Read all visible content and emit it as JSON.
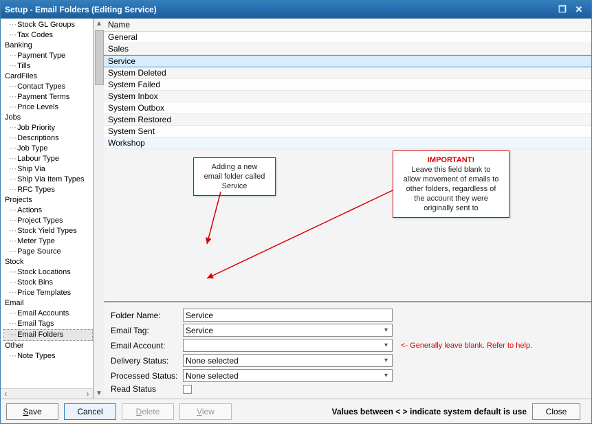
{
  "window": {
    "title": "Setup - Email Folders (Editing Service)"
  },
  "tree": {
    "groups": [
      {
        "label": "",
        "items": [
          "Stock GL Groups",
          "Tax Codes"
        ]
      },
      {
        "label": "Banking",
        "items": [
          "Payment Type",
          "Tills"
        ]
      },
      {
        "label": "CardFiles",
        "items": [
          "Contact Types",
          "Payment Terms",
          "Price Levels"
        ]
      },
      {
        "label": "Jobs",
        "items": [
          "Job Priority",
          "Descriptions",
          "Job Type",
          "Labour Type",
          "Ship Via",
          "Ship Via Item Types",
          "RFC Types"
        ]
      },
      {
        "label": "Projects",
        "items": [
          "Actions",
          "Project Types",
          "Stock Yield Types",
          "Meter Type",
          "Page Source"
        ]
      },
      {
        "label": "Stock",
        "items": [
          "Stock Locations",
          "Stock Bins",
          "Price Templates"
        ]
      },
      {
        "label": "Email",
        "items": [
          "Email Accounts",
          "Email Tags",
          "Email Folders"
        ]
      },
      {
        "label": "Other",
        "items": [
          "Note Types"
        ]
      }
    ],
    "selected": "Email Folders"
  },
  "grid": {
    "header": "Name",
    "rows": [
      "General",
      "Sales",
      "Service",
      "System Deleted",
      "System Failed",
      "System Inbox",
      "System Outbox",
      "System Restored",
      "System Sent",
      "Workshop"
    ],
    "selected": "Service",
    "hover": "Workshop"
  },
  "callouts": {
    "add": "Adding a new\nemail folder called\nService",
    "important_title": "IMPORTANT!",
    "important_body": "Leave this field blank to\nallow movement of emails to\nother folders, regardless of\nthe account they were\noriginally sent to"
  },
  "form": {
    "folder_name": {
      "label": "Folder Name:",
      "value": "Service"
    },
    "email_tag": {
      "label": "Email Tag:",
      "value": "Service"
    },
    "email_account": {
      "label": "Email Account:",
      "value": "",
      "hint": "<- Generally leave blank.  Refer to help."
    },
    "delivery_status": {
      "label": "Delivery Status:",
      "value": "None selected"
    },
    "processed_status": {
      "label": "Processed Status:",
      "value": "None selected"
    },
    "read_status": {
      "label": "Read Status"
    }
  },
  "footer": {
    "save": "Save",
    "cancel": "Cancel",
    "delete": "Delete",
    "view": "View",
    "close": "Close",
    "status": "Values between < > indicate system default is use"
  }
}
